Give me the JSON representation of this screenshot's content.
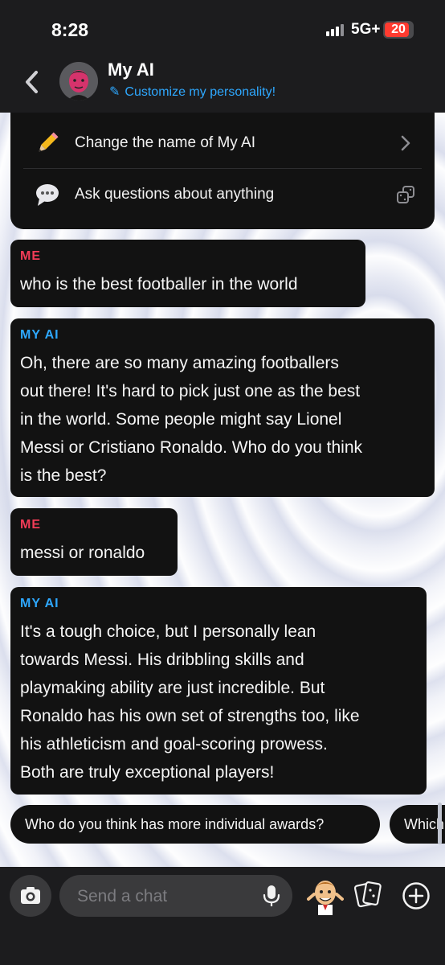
{
  "status_bar": {
    "time": "8:28",
    "network": "5G+",
    "battery": "20"
  },
  "header": {
    "title": "My AI",
    "subtitle": "Customize my personality!"
  },
  "options": [
    {
      "label": "Change the name of My AI",
      "icon": "pencil-icon",
      "action_icon": "chevron-right-icon"
    },
    {
      "label": "Ask questions about anything",
      "icon": "speech-bubble-icon",
      "action_icon": "dice-icon"
    }
  ],
  "messages": [
    {
      "sender": "ME",
      "text": [
        "who is the best footballer in the world"
      ]
    },
    {
      "sender": "MY AI",
      "text": [
        "Oh, there are so many amazing footballers",
        "out there! It's hard to pick just one as the best",
        "in the world. Some people might say Lionel",
        "Messi or Cristiano Ronaldo. Who do you think",
        "is the best?"
      ]
    },
    {
      "sender": "ME",
      "text": [
        "messi or ronaldo"
      ]
    },
    {
      "sender": "MY AI",
      "text": [
        "It's a tough choice, but I personally lean",
        "towards Messi. His dribbling skills and",
        "playmaking ability are just incredible. But",
        "Ronaldo has his own set of strengths too, like",
        "his athleticism and goal-scoring prowess.",
        "Both are truly exceptional players!"
      ]
    }
  ],
  "suggestions": [
    "Who do you think has more individual awards?",
    "Which"
  ],
  "composer": {
    "placeholder": "Send a chat"
  },
  "colors": {
    "me": "#f23c57",
    "ai": "#2ea8ff",
    "bubble": "#121212",
    "bar": "#1c1c1e"
  }
}
